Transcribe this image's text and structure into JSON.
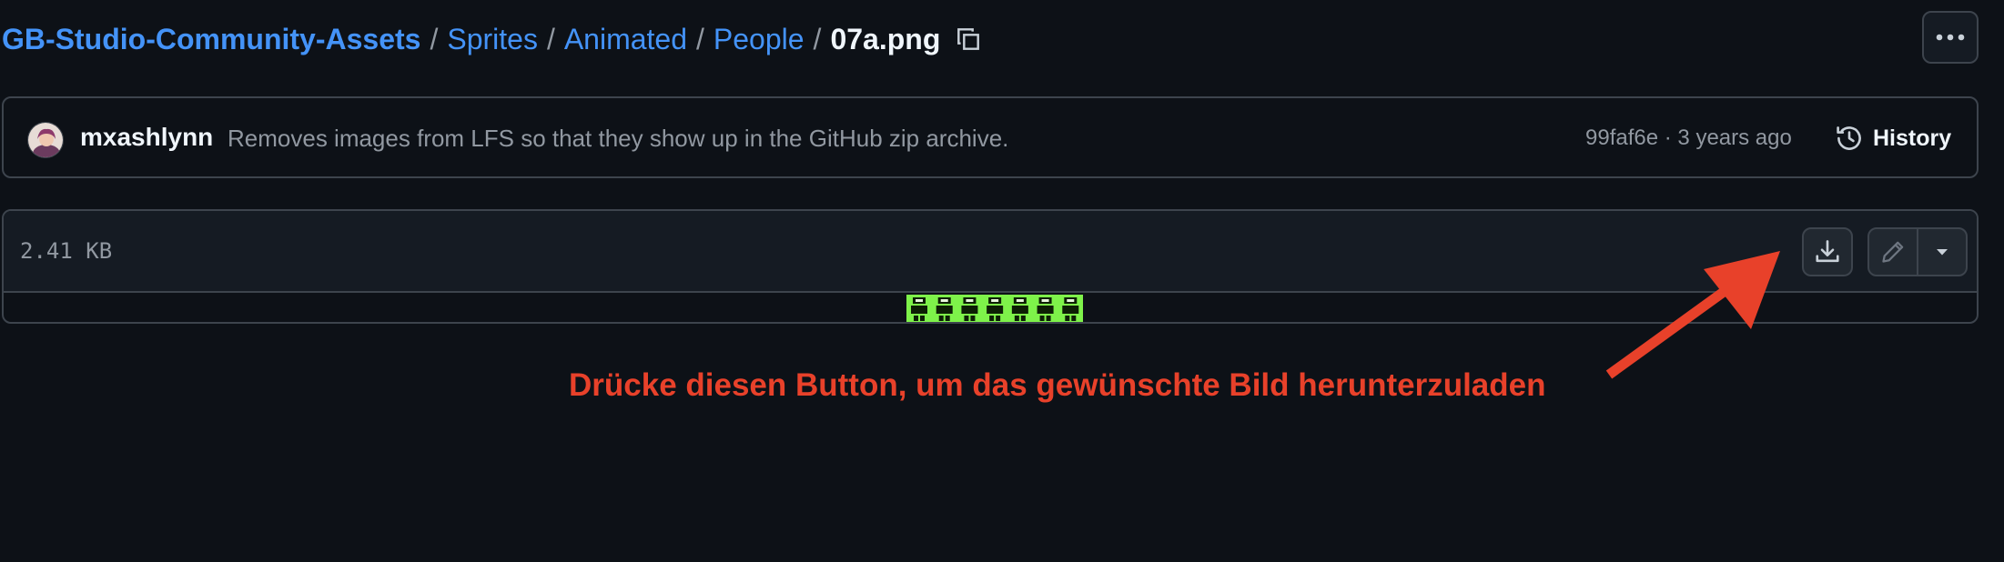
{
  "breadcrumb": {
    "repo": "GB-Studio-Community-Assets",
    "path": [
      "Sprites",
      "Animated",
      "People"
    ],
    "separator": "/",
    "file": "07a.png",
    "copy_icon": "copy-icon"
  },
  "header": {
    "more_icon": "kebab-horizontal-icon"
  },
  "commit": {
    "author": "mxashlynn",
    "message": "Removes images from LFS so that they show up in the GitHub zip archive.",
    "sha": "99faf6e",
    "meta_separator": "·",
    "time": "3 years ago",
    "history_label": "History",
    "history_icon": "history-icon"
  },
  "file": {
    "size": "2.41 KB",
    "download_icon": "download-icon",
    "edit_icon": "pencil-icon",
    "dropdown_icon": "triangle-down-icon",
    "preview_color": "#7ef24a"
  },
  "annotation": {
    "text": "Drücke diesen Button, um das gewünschte Bild herunterzuladen",
    "color": "#e8412a"
  },
  "colors": {
    "background": "#0d1117",
    "link": "#4493f8",
    "border": "#3d444d",
    "muted": "#9198a1"
  }
}
